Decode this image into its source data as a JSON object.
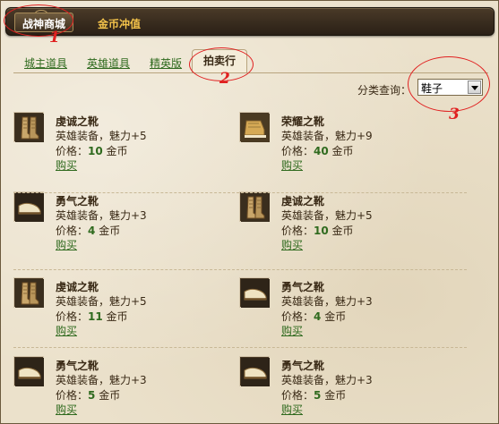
{
  "header": {
    "tab_active": "战神商城",
    "tab_recharge": "金币冲值"
  },
  "subtabs": {
    "items": [
      "城主道具",
      "英雄道具",
      "精英版"
    ],
    "active": "拍卖行"
  },
  "filter": {
    "label": "分类查询：",
    "selected": "鞋子"
  },
  "annotations": [
    "1",
    "2",
    "3"
  ],
  "items": [
    {
      "name": "虔诚之靴",
      "desc": "英雄装备，魅力+5",
      "price_prefix": "价格：",
      "price": "10",
      "price_unit": " 金币",
      "buy": "购买",
      "icon": "boots-icon"
    },
    {
      "name": "荣耀之靴",
      "desc": "英雄装备，魅力+9",
      "price_prefix": "价格：",
      "price": "40",
      "price_unit": " 金币",
      "buy": "购买",
      "icon": "sandal-icon"
    },
    {
      "name": "勇气之靴",
      "desc": "英雄装备，魅力+3",
      "price_prefix": "价格：",
      "price": "4",
      "price_unit": " 金币",
      "buy": "购买",
      "icon": "shoe-icon"
    },
    {
      "name": "虔诚之靴",
      "desc": "英雄装备，魅力+5",
      "price_prefix": "价格：",
      "price": "10",
      "price_unit": " 金币",
      "buy": "购买",
      "icon": "boots-icon"
    },
    {
      "name": "虔诚之靴",
      "desc": "英雄装备，魅力+5",
      "price_prefix": "价格：",
      "price": "11",
      "price_unit": " 金币",
      "buy": "购买",
      "icon": "boots-icon"
    },
    {
      "name": "勇气之靴",
      "desc": "英雄装备，魅力+3",
      "price_prefix": "价格：",
      "price": "4",
      "price_unit": " 金币",
      "buy": "购买",
      "icon": "shoe-icon"
    },
    {
      "name": "勇气之靴",
      "desc": "英雄装备，魅力+3",
      "price_prefix": "价格：",
      "price": "5",
      "price_unit": " 金币",
      "buy": "购买",
      "icon": "shoe-icon"
    },
    {
      "name": "勇气之靴",
      "desc": "英雄装备，魅力+3",
      "price_prefix": "价格：",
      "price": "5",
      "price_unit": " 金币",
      "buy": "购买",
      "icon": "shoe-icon"
    }
  ],
  "colors": {
    "annotation": "#e02020",
    "link": "#2f6a1e",
    "gold_tab": "#f3c24a"
  }
}
